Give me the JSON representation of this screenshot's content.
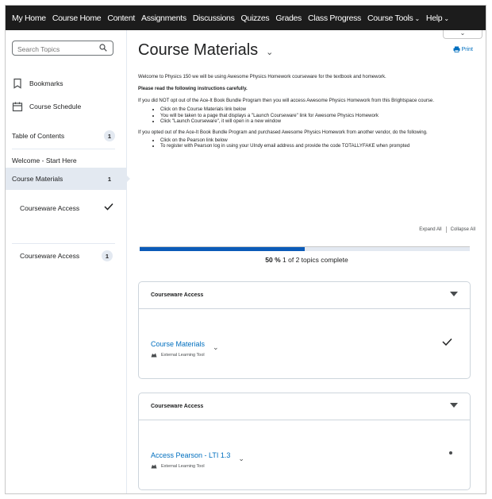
{
  "navbar": {
    "items": [
      "My Home",
      "Course Home",
      "Content",
      "Assignments",
      "Discussions",
      "Quizzes",
      "Grades",
      "Class Progress",
      "Course Tools",
      "Help"
    ]
  },
  "sidebar": {
    "search_placeholder": "Search Topics",
    "bookmarks": "Bookmarks",
    "course_schedule": "Course Schedule",
    "toc": [
      {
        "label": "Table of Contents",
        "count": "1"
      },
      {
        "label": "Welcome - Start Here"
      },
      {
        "label": "Course Materials",
        "count": "1"
      }
    ],
    "sub_items": [
      {
        "label": "Courseware Access"
      },
      {
        "label": "Courseware Access",
        "count": "1"
      }
    ]
  },
  "main": {
    "title": "Course Materials",
    "print_label": "Print",
    "description": {
      "intro": "Welcome to Physics 150 we will be using Awesome Physics Homework courseware for the textbook and homework.",
      "instructions_heading": "Please read the following instructions carefully.",
      "para1": "If you did NOT opt out of the Ace-It Book Bundle Program then you will access Awesome Physics Homework from this Brightspace course.",
      "list1": [
        "Click on the Course Materials link below",
        "You will be taken to a page that displays a \"Launch Courseware\" link for Awesome Physics Homework",
        "Click \"Launch Courseware\", it will open in a new window"
      ],
      "para2": "If you opted out of the Ace-It Book Bundle Program and purchased Awesome Physics Homework from another vendor, do the following.",
      "list2": [
        "Click on the Pearson link below",
        "To register with Pearson log in using your UIndy email address and provide the code TOTALLYFAKE when prompted"
      ]
    },
    "expand_all": "Expand All",
    "collapse_all": "Collapse All",
    "progress": {
      "percent_label": "50 %",
      "fraction": 0.5,
      "text": "1 of 2 topics complete"
    },
    "modules": [
      {
        "header": "Courseware Access",
        "item_title": "Course Materials",
        "item_type": "External Learning Tool",
        "status": "completed"
      },
      {
        "header": "Courseware Access",
        "item_title": "Access Pearson - LTI 1.3",
        "item_type": "External Learning Tool",
        "status": "incomplete"
      }
    ]
  }
}
